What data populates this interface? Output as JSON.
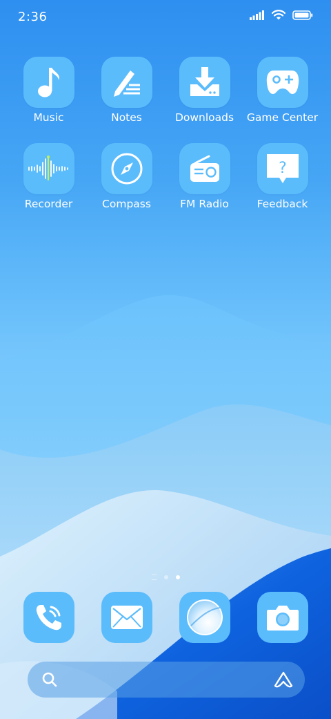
{
  "status_bar": {
    "time": "2:36"
  },
  "apps": [
    {
      "label": "Music",
      "icon": "music-icon"
    },
    {
      "label": "Notes",
      "icon": "notes-icon"
    },
    {
      "label": "Downloads",
      "icon": "download-icon"
    },
    {
      "label": "Game Center",
      "icon": "gamepad-icon"
    },
    {
      "label": "Recorder",
      "icon": "waveform-icon"
    },
    {
      "label": "Compass",
      "icon": "compass-icon"
    },
    {
      "label": "FM Radio",
      "icon": "radio-icon"
    },
    {
      "label": "Feedback",
      "icon": "feedback-icon"
    }
  ],
  "page_indicator": {
    "pages": 2,
    "current": 2
  },
  "dock": [
    {
      "icon": "phone-icon"
    },
    {
      "icon": "mail-icon"
    },
    {
      "icon": "browser-icon"
    },
    {
      "icon": "camera-icon"
    }
  ],
  "search": {
    "placeholder": "",
    "icon": "search-icon",
    "assistant_icon": "assistant-icon"
  },
  "colors": {
    "tile": "#5bbcfc",
    "accent_green": "#c8f050",
    "dock_blue": "#0a5fd8"
  }
}
